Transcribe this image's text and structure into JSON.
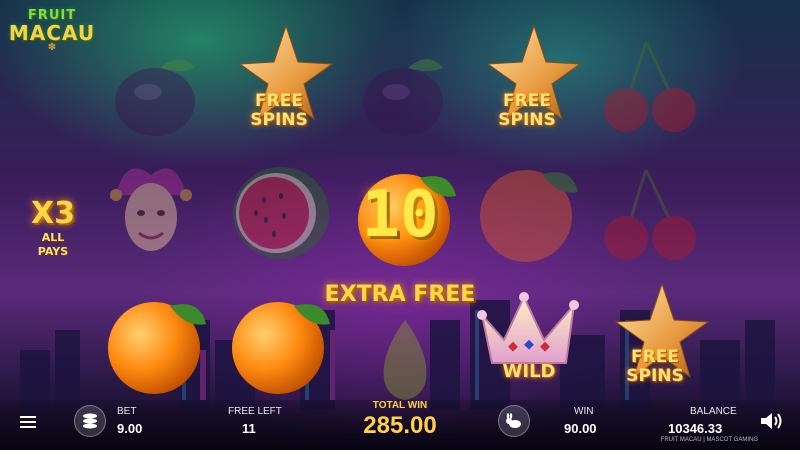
{
  "game": {
    "logo_line1": "FRUIT",
    "logo_line2": "MACAU"
  },
  "multiplier": {
    "value": "X3",
    "line1": "ALL",
    "line2": "PAYS"
  },
  "reels": {
    "free_spins_line1": "FREE",
    "free_spins_line2": "SPINS",
    "wild_label": "WILD",
    "symbols": [
      [
        "plum",
        "joker",
        "orange"
      ],
      [
        "free-spins-star",
        "watermelon",
        "orange"
      ],
      [
        "plum",
        "orange",
        "pear"
      ],
      [
        "free-spins-star",
        "orange",
        "wild-crown"
      ],
      [
        "cherries",
        "cherries",
        "free-spins-star"
      ]
    ]
  },
  "feature": {
    "count": "10",
    "text": "EXTRA FREE"
  },
  "bottom_bar": {
    "bet_label": "BET",
    "bet_value": "9.00",
    "free_left_label": "FREE LEFT",
    "free_left_value": "11",
    "total_win_label": "TOTAL WIN",
    "total_win_value": "285.00",
    "win_label": "WIN",
    "win_value": "90.00",
    "balance_label": "BALANCE",
    "balance_value": "10346.33",
    "credit": "FRUIT MACAU | MASCOT GAMING"
  },
  "icons": [
    "menu-icon",
    "coins-icon",
    "turbo-rabbit-icon",
    "speaker-icon"
  ],
  "colors": {
    "gold": "#ffd24a",
    "accent_green": "#7be04a"
  }
}
